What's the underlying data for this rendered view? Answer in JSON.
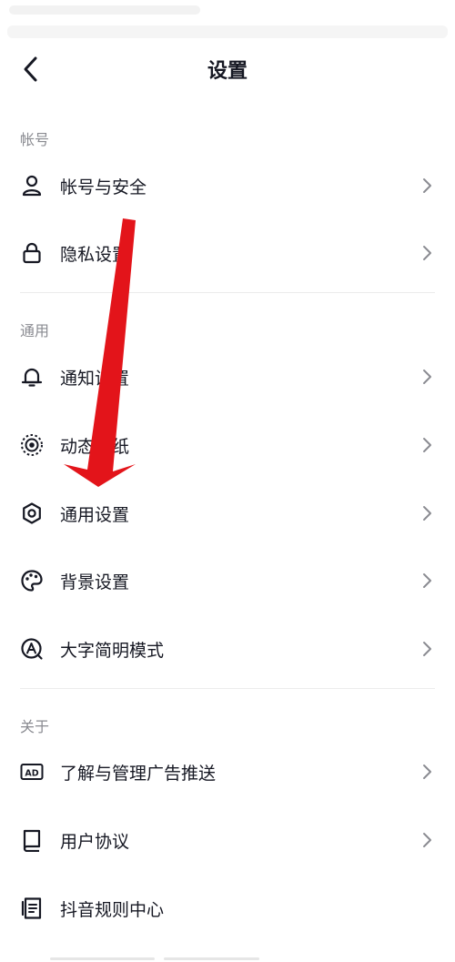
{
  "header": {
    "title": "设置"
  },
  "sections": [
    {
      "label": "帐号",
      "items": [
        {
          "label": "帐号与安全",
          "icon": "person-icon",
          "chevron": true
        },
        {
          "label": "隐私设置",
          "icon": "lock-icon",
          "chevron": true
        }
      ]
    },
    {
      "label": "通用",
      "items": [
        {
          "label": "通知设置",
          "icon": "bell-icon",
          "chevron": true
        },
        {
          "label": "动态壁纸",
          "icon": "live-wallpaper-icon",
          "chevron": true
        },
        {
          "label": "通用设置",
          "icon": "gear-icon",
          "chevron": true
        },
        {
          "label": "背景设置",
          "icon": "palette-icon",
          "chevron": true
        },
        {
          "label": "大字简明模式",
          "icon": "large-text-icon",
          "chevron": true
        }
      ]
    },
    {
      "label": "关于",
      "items": [
        {
          "label": "了解与管理广告推送",
          "icon": "ad-icon",
          "chevron": true
        },
        {
          "label": "用户协议",
          "icon": "book-icon",
          "chevron": true
        },
        {
          "label": "抖音规则中心",
          "icon": "document-icon",
          "chevron": false
        }
      ]
    }
  ],
  "annotation": {
    "color": "#e3141a"
  }
}
